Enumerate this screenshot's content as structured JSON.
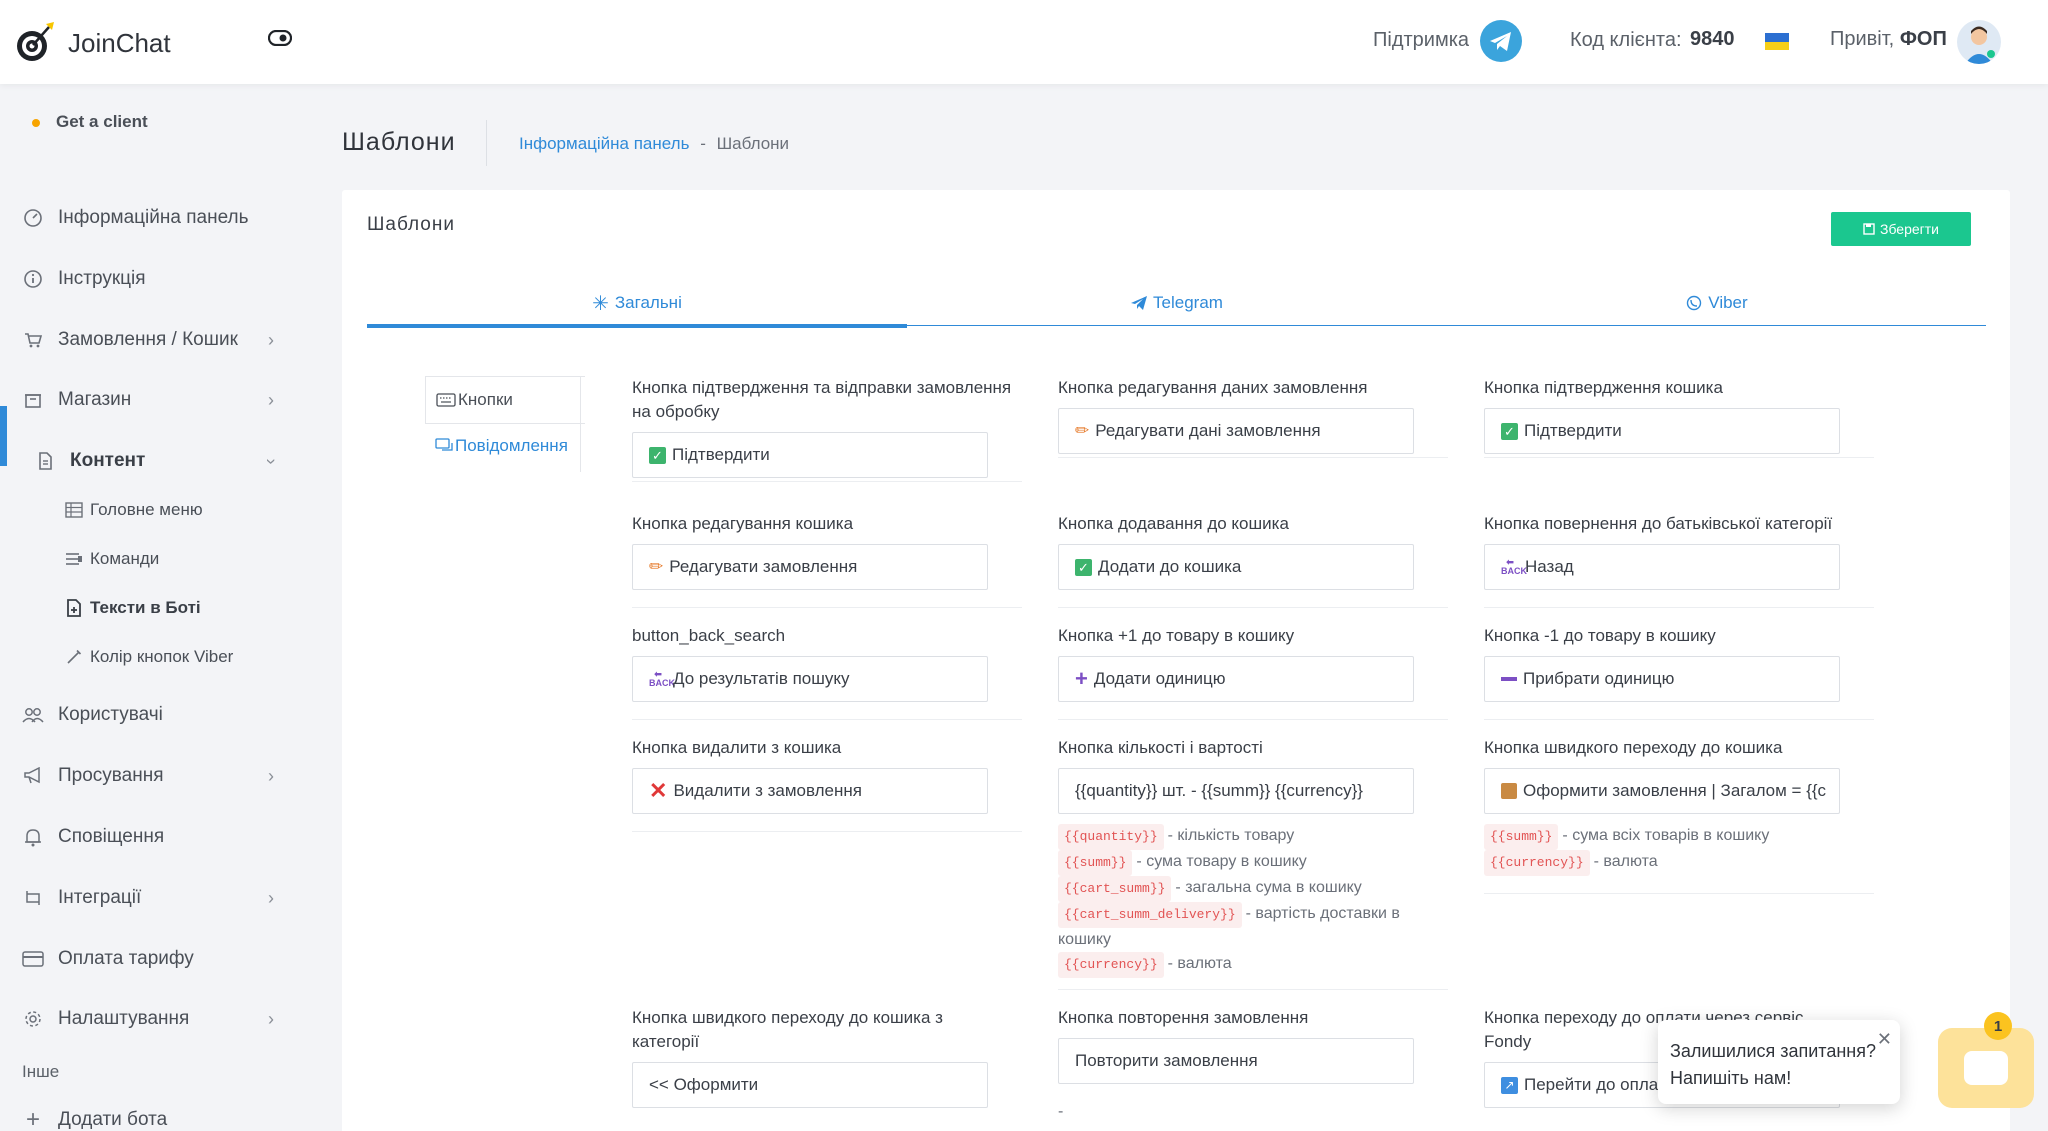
{
  "header": {
    "brand": "JoinChat",
    "support_label": "Підтримка",
    "client_code_label": "Код клієнта:",
    "client_code": "9840",
    "greeting": "Привіт,",
    "user_name": "ФОП"
  },
  "sidebar": {
    "get_client": "Get a client",
    "items": [
      {
        "label": "Інформаційна панель",
        "icon": "dashboard-icon"
      },
      {
        "label": "Інструкція",
        "icon": "info-icon"
      },
      {
        "label": "Замовлення / Кошик",
        "icon": "cart-icon"
      },
      {
        "label": "Магазин",
        "icon": "store-icon"
      },
      {
        "label": "Контент",
        "icon": "document-icon"
      },
      {
        "label": "Користувачі",
        "icon": "users-icon"
      },
      {
        "label": "Просування",
        "icon": "megaphone-icon"
      },
      {
        "label": "Сповіщення",
        "icon": "bell-icon"
      },
      {
        "label": "Інтеграції",
        "icon": "integration-icon"
      },
      {
        "label": "Оплата тарифу",
        "icon": "card-icon"
      },
      {
        "label": "Налаштування",
        "icon": "gear-icon"
      }
    ],
    "sub_items": [
      {
        "label": "Головне меню"
      },
      {
        "label": "Команди"
      },
      {
        "label": "Тексти в Боті"
      },
      {
        "label": "Колір кнопок Viber"
      }
    ],
    "other_label": "Інше",
    "add_bot": "Додати бота"
  },
  "page": {
    "title": "Шаблони",
    "breadcrumb_link": "Інформаційна панель",
    "breadcrumb_sep": "-",
    "breadcrumb_current": "Шаблони"
  },
  "card": {
    "title": "Шаблони",
    "save_label": "Зберегти",
    "tabs": [
      "Загальні",
      "Telegram",
      "Viber"
    ],
    "vtabs": [
      "Кнопки",
      "Повідомлення"
    ]
  },
  "fields": [
    {
      "label": "Кнопка підтвердження та відправки замовлення на обробку",
      "value": "Підтвердити"
    },
    {
      "label": "Кнопка редагування даних замовлення",
      "value": "Редагувати дані замовлення"
    },
    {
      "label": "Кнопка підтвердження кошика",
      "value": "Підтвердити"
    },
    {
      "label": "Кнопка редагування кошика",
      "value": "Редагувати замовлення"
    },
    {
      "label": "Кнопка додавання до кошика",
      "value": "Додати до кошика"
    },
    {
      "label": "Кнопка повернення до батьківської категорії",
      "value": "Назад"
    },
    {
      "label": "button_back_search",
      "value": "До результатів пошуку"
    },
    {
      "label": "Кнопка +1 до товару в кошику",
      "value": "Додати одиницю"
    },
    {
      "label": "Кнопка -1 до товару в кошику",
      "value": "Прибрати одиницю"
    },
    {
      "label": "Кнопка видалити з кошика",
      "value": "Видалити з замовлення"
    },
    {
      "label": "Кнопка кількості і вартості",
      "value": "{{quantity}} шт. - {{summ}} {{currency}}"
    },
    {
      "label": "Кнопка швидкого переходу до кошика",
      "value": "Оформити замовлення | Загалом = {{c"
    },
    {
      "label": "Кнопка швидкого переходу до кошика з категорії",
      "value": "<< Оформити"
    },
    {
      "label": "Кнопка повторення замовлення",
      "value": "Повторити замовлення"
    },
    {
      "label": "Кнопка переходу до оплати через сервіс Fondy",
      "value": "Перейти до оплати"
    }
  ],
  "hints_qty": [
    {
      "tag": "{{quantity}}",
      "text": "- кількість товару"
    },
    {
      "tag": "{{summ}}",
      "text": "- сума товару в кошику"
    },
    {
      "tag": "{{cart_summ}}",
      "text": "- загальна сума в кошику"
    },
    {
      "tag": "{{cart_summ_delivery}}",
      "text": "- вартість доставки в кошику"
    },
    {
      "tag": "{{currency}}",
      "text": "- валюта"
    }
  ],
  "hints_cart": [
    {
      "tag": "{{summ}}",
      "text": "- сума всіх товарів в кошику"
    },
    {
      "tag": "{{currency}}",
      "text": "- валюта"
    }
  ],
  "repeat_hint": "-",
  "chat": {
    "line1": "Залишилися запитання?",
    "line2": "Напишіть нам!",
    "badge": "1"
  },
  "colors": {
    "accent": "#2f8ad8",
    "save": "#1bc78f",
    "tag": "#e25454"
  }
}
